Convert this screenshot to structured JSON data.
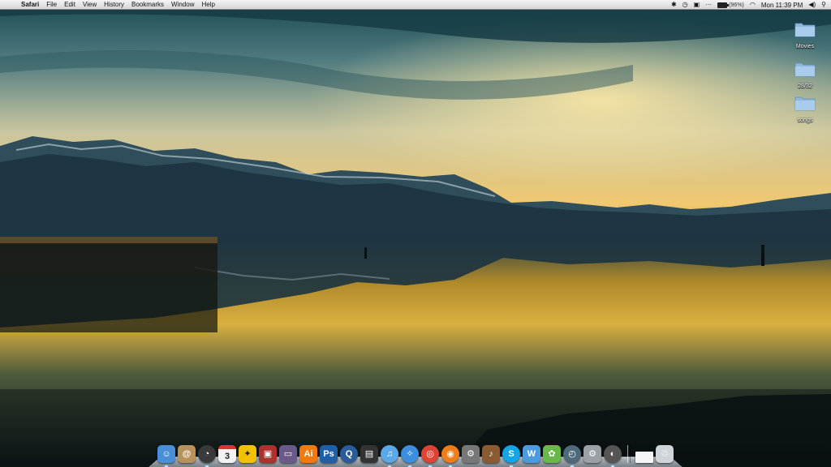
{
  "menubar": {
    "apple_icon": "apple-icon",
    "items": [
      "Safari",
      "File",
      "Edit",
      "View",
      "History",
      "Bookmarks",
      "Window",
      "Help"
    ],
    "status": {
      "icons": [
        "bluetooth-icon",
        "time-machine-icon",
        "display-icon",
        "dots-icon"
      ],
      "battery_percent": 96,
      "battery_text": "(96%)",
      "wifi_icon": "wifi-icon",
      "clock": "Mon 11:39 PM",
      "volume_icon": "volume-icon",
      "spotlight_icon": "spotlight-icon"
    }
  },
  "desktop": {
    "icons": [
      {
        "label": "Movies"
      },
      {
        "label": "28/32"
      },
      {
        "label": "songs"
      }
    ]
  },
  "calendar": {
    "day": "3"
  },
  "dock": {
    "apps": [
      {
        "name": "finder",
        "glyph": "☺",
        "color": "#4a8fd6"
      },
      {
        "name": "address-book",
        "glyph": "@",
        "color": "#b8925a"
      },
      {
        "name": "dashboard",
        "glyph": "◔",
        "color": "#3a3a3a"
      },
      {
        "name": "ical",
        "glyph": "3",
        "color": "#f2f2f2"
      },
      {
        "name": "aim",
        "glyph": "✦",
        "color": "#f2c200"
      },
      {
        "name": "photo-booth",
        "glyph": "▣",
        "color": "#b03030"
      },
      {
        "name": "front-row",
        "glyph": "▭",
        "color": "#6a5a8a"
      },
      {
        "name": "illustrator",
        "glyph": "Ai",
        "color": "#f07a10"
      },
      {
        "name": "photoshop",
        "glyph": "Ps",
        "color": "#1f5fa8"
      },
      {
        "name": "quicktime",
        "glyph": "Q",
        "color": "#2a5c9c"
      },
      {
        "name": "clapper",
        "glyph": "▤",
        "color": "#333333"
      },
      {
        "name": "itunes",
        "glyph": "♫",
        "color": "#5ba8e8"
      },
      {
        "name": "safari",
        "glyph": "✧",
        "color": "#3d8ee0"
      },
      {
        "name": "chrome",
        "glyph": "◎",
        "color": "#dd4433"
      },
      {
        "name": "firefox",
        "glyph": "◉",
        "color": "#ef7d1a"
      },
      {
        "name": "automator",
        "glyph": "⚙",
        "color": "#777777"
      },
      {
        "name": "garageband",
        "glyph": "♪",
        "color": "#8a5a30"
      },
      {
        "name": "skype",
        "glyph": "S",
        "color": "#12a5e8"
      },
      {
        "name": "wuala",
        "glyph": "W",
        "color": "#4c9be0"
      },
      {
        "name": "tweetie",
        "glyph": "✿",
        "color": "#6bb84a"
      },
      {
        "name": "time-machine",
        "glyph": "◴",
        "color": "#4e6a7a"
      },
      {
        "name": "system-preferences",
        "glyph": "⚙",
        "color": "#9aa0a6"
      },
      {
        "name": "quicksilver",
        "glyph": "◐",
        "color": "#555555"
      }
    ],
    "trailing": [
      {
        "name": "document-stack",
        "glyph": "",
        "color": "#f5f5f5"
      },
      {
        "name": "trash",
        "glyph": "♲",
        "color": "#cfd4d8"
      }
    ]
  }
}
